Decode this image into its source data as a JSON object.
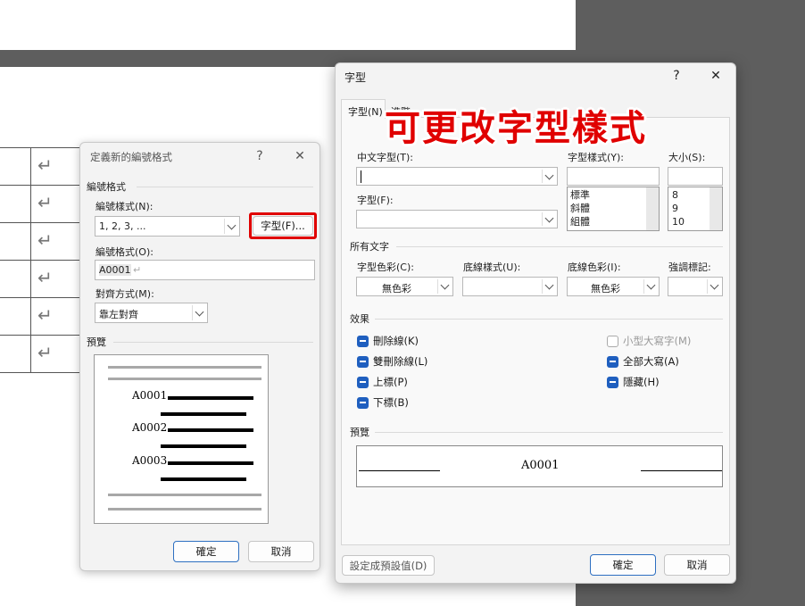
{
  "background": {
    "page_color": "#ffffff",
    "dark_color": "#5e5e5e"
  },
  "table_rows": [
    {
      "mark": "↵"
    },
    {
      "mark": "↵"
    },
    {
      "mark": "↵"
    },
    {
      "mark": "↵"
    },
    {
      "mark": "↵"
    },
    {
      "mark": "↵"
    }
  ],
  "numbering_dialog": {
    "title": "定義新的編號格式",
    "help": "?",
    "close": "✕",
    "section_format": "編號格式",
    "style_label": "編號樣式(N):",
    "style_value": "1, 2, 3, ...",
    "font_button": "字型(F)...",
    "format_label": "編號格式(O):",
    "format_value": "A0001",
    "format_mark": "↵",
    "align_label": "對齊方式(M):",
    "align_value": "靠左對齊",
    "preview_label": "預覽",
    "preview_items": [
      "A0001",
      "A0002",
      "A0003"
    ],
    "ok": "確定",
    "cancel": "取消"
  },
  "font_dialog": {
    "title": "字型",
    "help": "?",
    "close": "✕",
    "tab_font": "字型(N)",
    "tab_advanced": "進階",
    "overlay_caption": "可更改字型樣式",
    "east_asian_font_label": "中文字型(T):",
    "east_asian_font_value": "",
    "font_label": "字型(F):",
    "font_value": "",
    "style_label": "字型樣式(Y):",
    "style_value": "",
    "style_options": [
      "標準",
      "斜體",
      "組體"
    ],
    "size_label": "大小(S):",
    "size_value": "",
    "size_options": [
      "8",
      "9",
      "10"
    ],
    "all_text_label": "所有文字",
    "font_color_label": "字型色彩(C):",
    "font_color_value": "無色彩",
    "underline_style_label": "底線樣式(U):",
    "underline_style_value": "",
    "underline_color_label": "底線色彩(I):",
    "underline_color_value": "無色彩",
    "emphasis_label": "強調標記:",
    "emphasis_value": "",
    "effects_label": "效果",
    "effects": [
      {
        "label": "刪除線(K)",
        "checked": true
      },
      {
        "label": "雙刪除線(L)",
        "checked": true
      },
      {
        "label": "上標(P)",
        "checked": true
      },
      {
        "label": "下標(B)",
        "checked": true
      },
      {
        "label": "小型大寫字(M)",
        "checked": false
      },
      {
        "label": "全部大寫(A)",
        "checked": true
      },
      {
        "label": "隱藏(H)",
        "checked": true
      }
    ],
    "preview_label": "預覽",
    "preview_text": "A0001",
    "set_default": "設定成預設值(D)",
    "ok": "確定",
    "cancel": "取消"
  }
}
